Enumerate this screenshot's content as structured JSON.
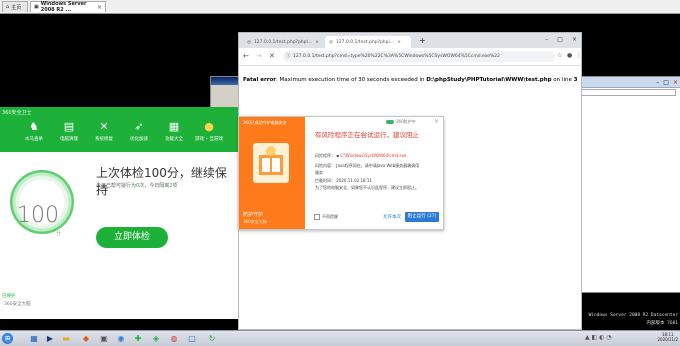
{
  "vm_tabs": {
    "home": "主页",
    "server": "Windows Server 2008 R2 ..."
  },
  "app360": {
    "brand": "360安全卫士",
    "tools": [
      {
        "label": "木马查杀",
        "icon": "horse-icon"
      },
      {
        "label": "电脑清理",
        "icon": "broom-icon"
      },
      {
        "label": "系统修复",
        "icon": "wrench-icon"
      },
      {
        "label": "优化加速",
        "icon": "rocket-icon"
      },
      {
        "label": "功能大全",
        "icon": "grid-icon"
      },
      {
        "label": "游戏 • 旦游戏",
        "icon": "coin-icon"
      }
    ],
    "score": "100",
    "score_unit": "分",
    "headline": "上次体检100分，继续保持",
    "subline_prefix": "今日已帮可疑行为",
    "subline_count1": "0",
    "subline_mid": "次，今日隔离",
    "subline_count2": "2",
    "subline_suffix": "项",
    "check_button": "立即体检",
    "status1": "已保护",
    "status2": "360安全大脑"
  },
  "chrome": {
    "tab1_title": "127.0.0.1/test.php?phpl...",
    "tab2_title": "127.0.0.1/test.php?phpi...",
    "new_tab": "+",
    "url": "127.0.0.1/test.php?cmd=type%20%22C%3A%5CWindows%5CSysWOW64%5Ccmd.exe%22",
    "error_bold": "Fatal error",
    "error_text": ": Maximum execution time of 30 seconds exceeded in ",
    "error_path": "D:\\phpStudy\\PHPTutorial\\WWW\\test.php",
    "error_line_text": " on line ",
    "error_line": "3"
  },
  "dialog": {
    "left_title": "360已成功守护电脑安全",
    "left_bottom": "防护守护",
    "left_bottom2": "360安全大脑",
    "badge": "360防护中",
    "title": "有风险程序正在尝试运行，建议阻止",
    "program_label": "风险程序：",
    "program_path": "C:\\Windows\\SysWOW64\\cmd.exe",
    "content_label": "风险内容：",
    "content_text": "Java程序同在，请中请Java Web服务器端调用",
    "content_text2": "服务",
    "time_label": "拦截时间：",
    "time_value": "2020.11.02 18:11",
    "advice": "为了您的电脑安全，如果您不认识此程序，建议立即阻止。",
    "checkbox_label": "不再提醒",
    "allow_link": "允许本次",
    "block_button": "阻止运行 (27)"
  },
  "watermark": {
    "line1": "Windows Server 2008 R2 Datacenter",
    "line2": "内部版本 7601"
  },
  "taskbar": {
    "time": "18:11",
    "date": "2020/11/2"
  }
}
